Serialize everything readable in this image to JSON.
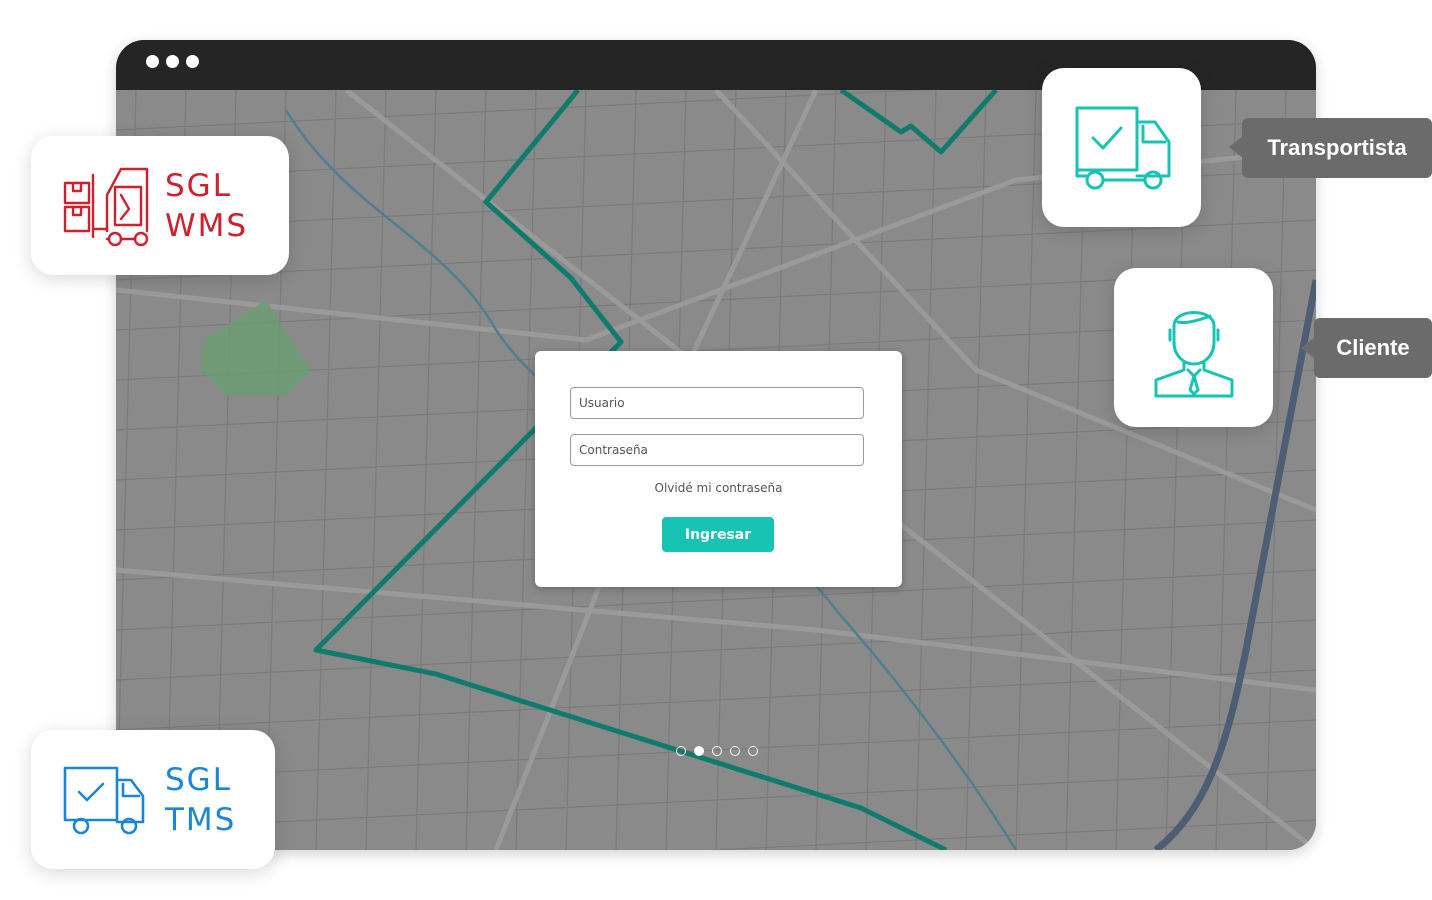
{
  "login": {
    "username_placeholder": "Usuario",
    "password_placeholder": "Contraseña",
    "forgot_label": "Olvidé mi contraseña",
    "submit_label": "Ingresar"
  },
  "carousel": {
    "total_slides": 5,
    "active_index": 1
  },
  "wms_card": {
    "line1": "SGL",
    "line2": "WMS",
    "color": "#d0202e",
    "icon": "forklift-icon"
  },
  "tms_card": {
    "line1": "SGL",
    "line2": "TMS",
    "color": "#1a86d8",
    "icon": "delivery-truck-icon"
  },
  "roles": {
    "carrier": {
      "label": "Transportista",
      "icon": "truck-check-icon",
      "color": "#17c4b4"
    },
    "client": {
      "label": "Cliente",
      "icon": "person-icon",
      "color": "#17c4b4"
    }
  },
  "colors": {
    "route": "#0f7b6c",
    "map_background": "#8a8a8a",
    "titlebar": "#252525"
  }
}
